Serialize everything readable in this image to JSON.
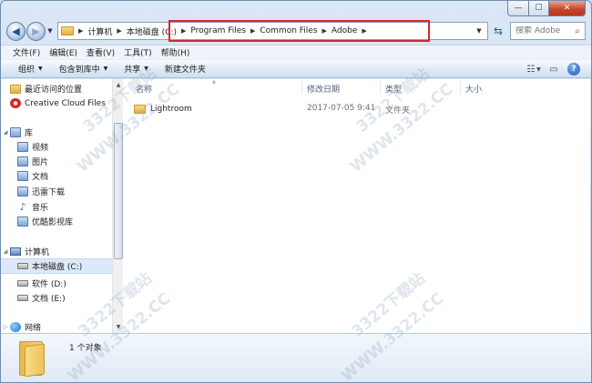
{
  "window": {
    "caption_buttons": {
      "minimize": "—",
      "maximize": "☐",
      "close": "✕"
    }
  },
  "navigation": {
    "back_glyph": "◀",
    "forward_glyph": "▶",
    "dropdown_glyph": "▼"
  },
  "address": {
    "crumbs": [
      "计算机",
      "本地磁盘 (C:)",
      "Program Files",
      "Common Files",
      "Adobe"
    ],
    "separator": "▶",
    "highlight_color": "#e0232c"
  },
  "search": {
    "placeholder": "搜索 Adobe"
  },
  "menu": [
    "文件(F)",
    "编辑(E)",
    "查看(V)",
    "工具(T)",
    "帮助(H)"
  ],
  "toolbar": {
    "organize": "组织",
    "include_in_library": "包含到库中",
    "share": "共享",
    "new_folder": "新建文件夹",
    "help": "?"
  },
  "nav_pane": {
    "recent": "最近访问的位置",
    "creative_cloud": "Creative Cloud Files",
    "libraries": "库",
    "videos": "视频",
    "pictures": "图片",
    "documents": "文档",
    "xunlei": "迅雷下载",
    "music": "音乐",
    "youku": "优酷影视库",
    "computer": "计算机",
    "drive_c": "本地磁盘 (C:)",
    "drive_d": "软件 (D:)",
    "drive_e": "文档 (E:)",
    "network": "网络"
  },
  "columns": {
    "name": "名称",
    "modified": "修改日期",
    "type": "类型",
    "size": "大小"
  },
  "files": [
    {
      "name": "Lightroom",
      "modified": "2017-07-05 9:41",
      "type": "文件夹",
      "size": ""
    }
  ],
  "status": {
    "count": "1 个对象"
  },
  "watermark": {
    "text": "WWW.3322.CC",
    "text2": "3322下载站"
  }
}
